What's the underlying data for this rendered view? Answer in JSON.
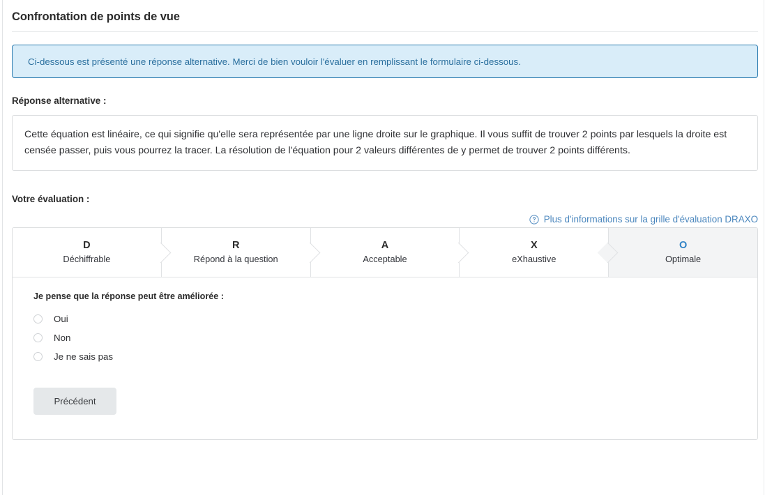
{
  "page": {
    "title": "Confrontation de points de vue"
  },
  "alert": {
    "message": "Ci-dessous est présenté une réponse alternative. Merci de bien vouloir l'évaluer en remplissant le formulaire ci-dessous.",
    "background_color": "#d9edf9",
    "border_color": "#2c7cb0",
    "text_color": "#2a6f9e"
  },
  "alternative_answer": {
    "label": "Réponse alternative :",
    "text": "Cette équation est linéaire, ce qui signifie qu'elle sera représentée par une ligne droite sur le graphique. Il vous suffit de trouver 2 points par lesquels la droite est censée passer, puis vous pourrez la tracer. La résolution de l'équation pour 2 valeurs différentes de y permet de trouver 2 points différents."
  },
  "evaluation": {
    "label": "Votre évaluation :",
    "help_link": {
      "icon": "question-circle-icon",
      "text": "Plus d'informations sur la grille d'évaluation DRAXO",
      "color": "#4a86bd"
    },
    "steps": [
      {
        "letter": "D",
        "name": "Déchiffrable",
        "active": false
      },
      {
        "letter": "R",
        "name": "Répond à la question",
        "active": false
      },
      {
        "letter": "A",
        "name": "Acceptable",
        "active": false
      },
      {
        "letter": "X",
        "name": "eXhaustive",
        "active": false
      },
      {
        "letter": "O",
        "name": "Optimale",
        "active": true
      }
    ],
    "active_step_letter_color": "#2f82c6",
    "active_step_background": "#f3f4f5",
    "question": {
      "label": "Je pense que la réponse peut être améliorée :",
      "options": [
        {
          "label": "Oui",
          "selected": false
        },
        {
          "label": "Non",
          "selected": false
        },
        {
          "label": "Je ne sais pas",
          "selected": false
        }
      ]
    },
    "buttons": {
      "previous": "Précédent"
    }
  }
}
